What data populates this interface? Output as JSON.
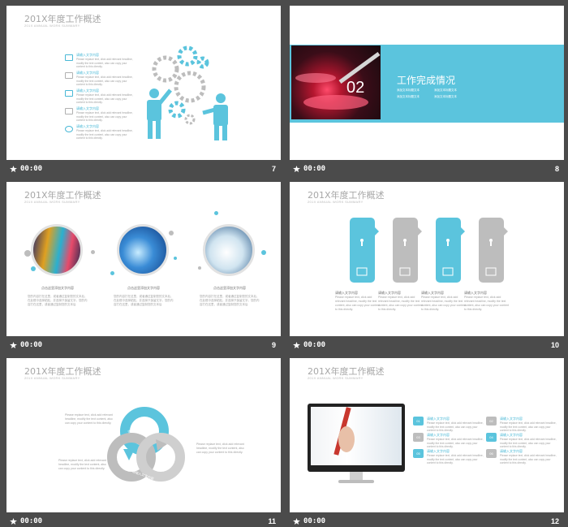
{
  "slides": [
    {
      "number": "7",
      "timing": "00:00",
      "title": "201X年度工作概述",
      "subtitle": "201X ANNUAL WORK SUMMARY",
      "items": [
        {
          "heading": "请输入文字内容",
          "text": "Please replace text, click add relevant headline, modify the text content, also can copy your content to this directly."
        },
        {
          "heading": "请输入文字内容",
          "text": "Please replace text, click add relevant headline, modify the text content, also can copy your content to this directly."
        },
        {
          "heading": "请输入文字内容",
          "text": "Please replace text, click add relevant headline, modify the text content, also can copy your content to this directly."
        },
        {
          "heading": "请输入文字内容",
          "text": "Please replace text, click add relevant headline, modify the text content, also can copy your content to this directly."
        },
        {
          "heading": "请输入文字内容",
          "text": "Please replace text, click add relevant headline, modify the text content, also can copy your content to this directly."
        }
      ]
    },
    {
      "number": "8",
      "timing": "00:00",
      "section_number": "02",
      "section_title": "工作完成情况",
      "bullets": [
        "添加文本标题文本",
        "添加文本标题文本",
        "添加文本标题文本",
        "添加文本标题文本"
      ]
    },
    {
      "number": "9",
      "timing": "00:00",
      "title": "201X年度工作概述",
      "subtitle": "201X ANNUAL WORK SUMMARY",
      "items": [
        {
          "heading": "点击这里添加文字内容",
          "text": "您的内容打在这里，或者通过复制您的文本后，在此框中选择粘贴，并选择只保留文字。您的内容打在这里，或者通过复制您的文本后"
        },
        {
          "heading": "点击这里添加文字内容",
          "text": "您的内容打在这里，或者通过复制您的文本后，在此框中选择粘贴，并选择只保留文字。您的内容打在这里，或者通过复制您的文本后"
        },
        {
          "heading": "点击这里添加文字内容",
          "text": "您的内容打在这里，或者通过复制您的文本后，在此框中选择粘贴，并选择只保留文字。您的内容打在这里，或者通过复制您的文本后"
        }
      ]
    },
    {
      "number": "10",
      "timing": "00:00",
      "title": "201X年度工作概述",
      "subtitle": "201X ANNUAL WORK SUMMARY",
      "items": [
        {
          "heading": "请输入文字内容",
          "text": "Please replace text, click add relevant headline, modify the text content, also can copy your content to this directly."
        },
        {
          "heading": "请输入文字内容",
          "text": "Please replace text, click add relevant headline, modify the text content, also can copy your content to this directly."
        },
        {
          "heading": "请输入文字内容",
          "text": "Please replace text, click add relevant headline, modify the text content, also can copy your content to this directly."
        },
        {
          "heading": "请输入文字内容",
          "text": "Please replace text, click add relevant headline, modify the text content, also can copy your content to this directly."
        }
      ]
    },
    {
      "number": "11",
      "timing": "00:00",
      "title": "201X年度工作概述",
      "subtitle": "201X ANNUAL WORK SUMMARY",
      "labels": [
        "请输入文字内容",
        "请输入文字内容"
      ],
      "texts": [
        "Please replace text, click add relevant headline, modify the text content, also can copy your content to this directly.",
        "Please replace text, click add relevant headline, modify the text content, also can copy your content to this directly.",
        "Please replace text, click add relevant headline, modify the text content, also can copy your content to this directly."
      ]
    },
    {
      "number": "12",
      "timing": "00:00",
      "title": "201X年度工作概述",
      "subtitle": "201X ANNUAL WORK SUMMARY",
      "items": [
        {
          "code": "01",
          "heading": "请输入文字内容",
          "text": "Please replace text, click add relevant headline, modify the text content, also can copy your content to this directly."
        },
        {
          "code": "02",
          "heading": "请输入文字内容",
          "text": "Please replace text, click add relevant headline, modify the text content, also can copy your content to this directly."
        },
        {
          "code": "03",
          "heading": "请输入文字内容",
          "text": "Please replace text, click add relevant headline, modify the text content, also can copy your content to this directly."
        },
        {
          "code": "04",
          "heading": "请输入文字内容",
          "text": "Please replace text, click add relevant headline, modify the text content, also can copy your content to this directly."
        },
        {
          "code": "05",
          "heading": "请输入文字内容",
          "text": "Please replace text, click add relevant headline, modify the text content, also can copy your content to this directly."
        },
        {
          "code": "06",
          "heading": "请输入文字内容",
          "text": "Please replace text, click add relevant headline, modify the text content, also can copy your content to this directly."
        }
      ]
    }
  ],
  "colors": {
    "accent": "#5bc4dd",
    "gray": "#bdbdbd",
    "background": "#4b4b4b"
  }
}
